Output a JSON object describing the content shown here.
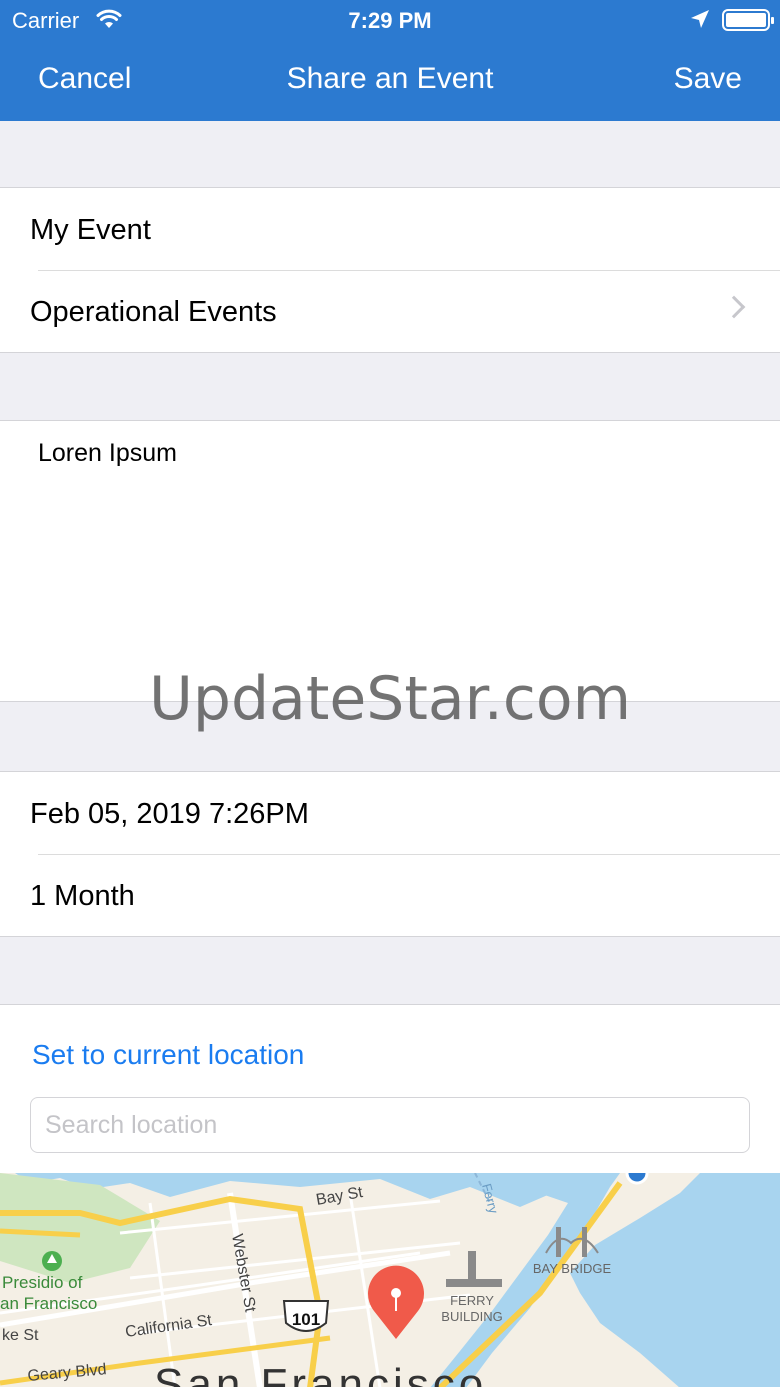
{
  "status_bar": {
    "carrier": "Carrier",
    "time": "7:29 PM"
  },
  "nav": {
    "cancel_label": "Cancel",
    "title": "Share an Event",
    "save_label": "Save"
  },
  "event": {
    "name": "My Event",
    "category": "Operational Events",
    "description": "Loren Ipsum"
  },
  "timing": {
    "datetime": "Feb 05, 2019 7:26PM",
    "duration": "1 Month"
  },
  "watermark": "UpdateStar.com",
  "location": {
    "current_location_label": "Set to current location",
    "search_placeholder": "Search location"
  },
  "map": {
    "labels": {
      "bay_st": "Bay St",
      "webster_st": "Webster St",
      "presidio_1": "Presidio of",
      "presidio_2": "an Francisco",
      "california_st": "California St",
      "highway": "101",
      "ferry_1": "FERRY",
      "ferry_2": "BUILDING",
      "bay_bridge": "BAY BRIDGE",
      "ke_st": "ke St",
      "geary_blvd": "Geary Blvd",
      "city": "San Francisco",
      "ferry_route": "Ferry"
    }
  },
  "colors": {
    "accent": "#2c7ad0",
    "link": "#1a7cf0",
    "pin": "#f05a4a",
    "water": "#a8d4ef",
    "land": "#f4efe5",
    "road": "#f8cf4a"
  }
}
